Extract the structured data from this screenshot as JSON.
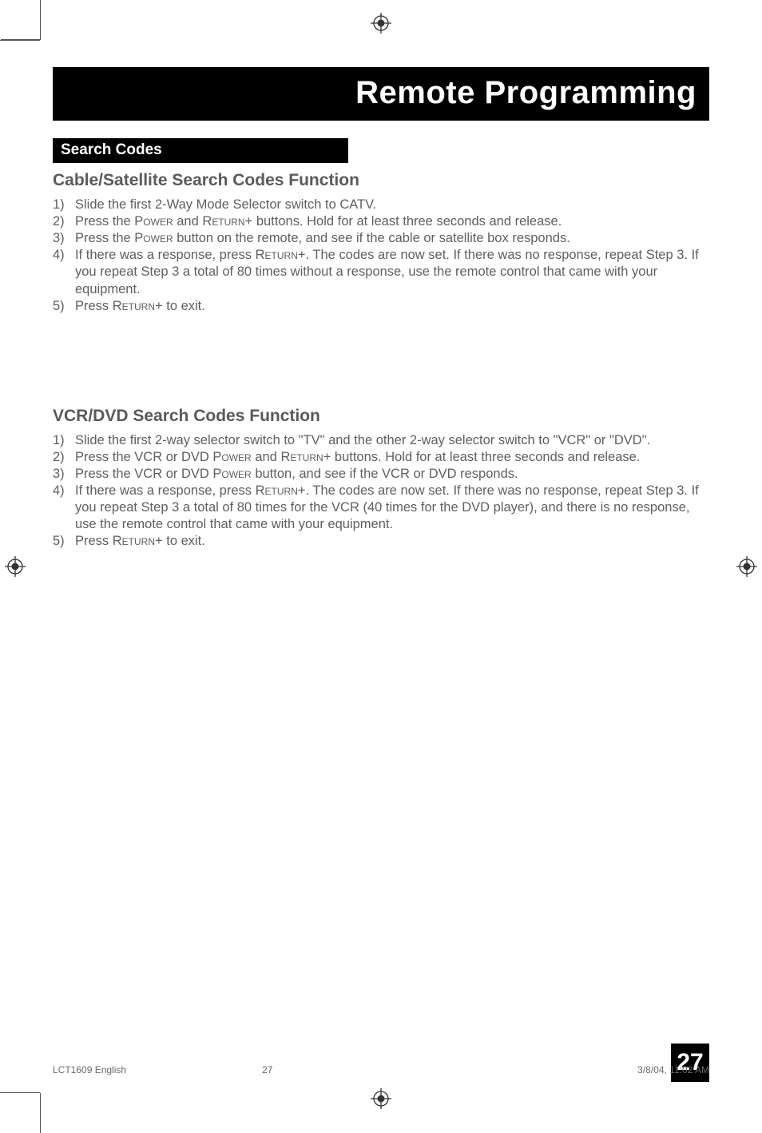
{
  "title": "Remote Programming",
  "section_label": "Search Codes",
  "cable": {
    "heading": "Cable/Satellite Search Codes Function",
    "steps": [
      {
        "n": "1)",
        "t": "Slide the first 2-Way Mode Selector switch to CATV."
      },
      {
        "n": "2)",
        "t": "Press the POWER and RETURN+ buttons.  Hold for at least three seconds and release."
      },
      {
        "n": "3)",
        "t": "Press the POWER button on the remote, and see if the cable or satellite box responds."
      },
      {
        "n": "4)",
        "t": "If there was a response, press RETURN+. The codes are now set. If there was no response, repeat Step 3. If you repeat Step 3 a total of 80 times without a response, use the remote control that came with your equipment."
      },
      {
        "n": "5)",
        "t": "Press RETURN+ to exit."
      }
    ]
  },
  "vcr": {
    "heading": "VCR/DVD Search Codes Function",
    "steps": [
      {
        "n": "1)",
        "t": "Slide the first 2-way selector switch to \"TV\" and the other 2-way selector switch to \"VCR\" or \"DVD\"."
      },
      {
        "n": "2)",
        "t": "Press the VCR or DVD POWER and RETURN+ buttons.  Hold for at least three seconds and release."
      },
      {
        "n": "3)",
        "t": "Press the VCR or DVD POWER button, and see if the VCR or DVD responds."
      },
      {
        "n": "4)",
        "t": "If there was a response, press RETURN+. The codes are now set. If there was no response, repeat Step 3. If you repeat Step 3 a total of 80 times for the VCR (40 times for the DVD player), and there is no response, use the remote control that came with your equipment."
      },
      {
        "n": "5)",
        "t": "Press RETURN+ to exit."
      }
    ]
  },
  "page_number": "27",
  "footer": {
    "doc": "LCT1609 English",
    "page": "27",
    "timestamp": "3/8/04, 11:02 AM"
  }
}
